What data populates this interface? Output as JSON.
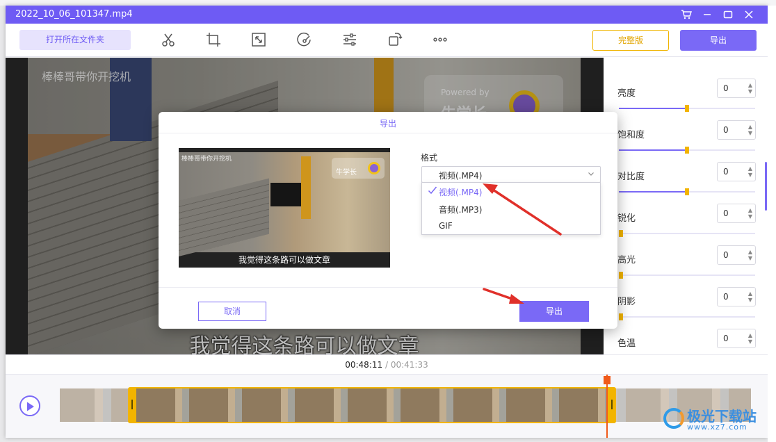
{
  "window": {
    "title": "2022_10_06_101347.mp4"
  },
  "toolbar": {
    "open_folder_label": "打开所在文件夹",
    "full_version_label": "完整版",
    "export_label": "导出"
  },
  "video": {
    "watermark_text": "棒棒哥带你开挖机",
    "powered_text": "Powered by",
    "brand_text": "牛学长",
    "subtitle": "我觉得这条路可以做文章"
  },
  "adjustments": {
    "items": [
      {
        "label": "亮度",
        "value": "0",
        "level": 0.5
      },
      {
        "label": "饱和度",
        "value": "0",
        "level": 0.5
      },
      {
        "label": "对比度",
        "value": "0",
        "level": 0.5
      },
      {
        "label": "锐化",
        "value": "0",
        "level": 0
      },
      {
        "label": "高光",
        "value": "0",
        "level": 0
      },
      {
        "label": "阴影",
        "value": "0",
        "level": 0
      },
      {
        "label": "色温",
        "value": "0",
        "level": 0.5
      }
    ]
  },
  "timeline": {
    "current_time": "00:48:11",
    "separator": "/",
    "total_time": "00:41:33"
  },
  "dialog": {
    "title": "导出",
    "preview_caption": "我觉得这条路可以做文章",
    "preview_brand": "牛学长",
    "format_label": "格式",
    "selected_format": "视频(.MP4)",
    "options": [
      "视频(.MP4)",
      "音频(.MP3)",
      "GIF"
    ],
    "selected_index": 0,
    "cancel_label": "取消",
    "export_label": "导出"
  },
  "site_watermark": {
    "name": "极光下载站",
    "url": "www.xz7.com"
  },
  "colors": {
    "accent": "#7a69f6",
    "title_bar": "#6e5bf4",
    "highlight_yellow": "#f2b400",
    "annotation_red": "#e0302a"
  }
}
